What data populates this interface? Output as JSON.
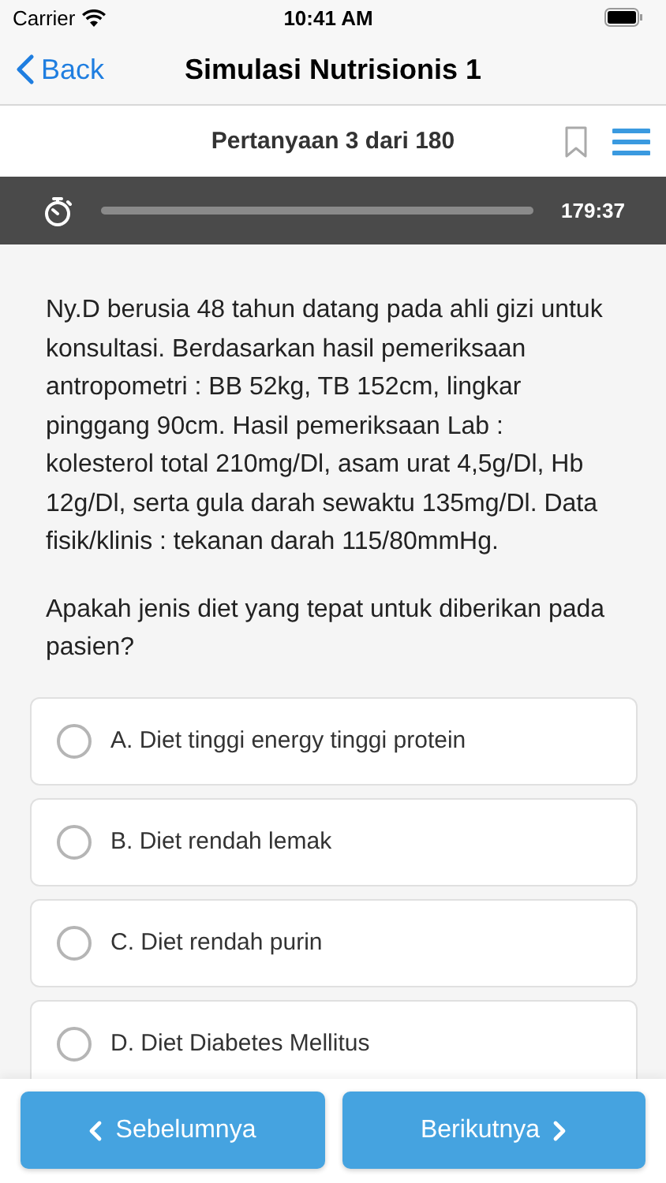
{
  "status_bar": {
    "carrier": "Carrier",
    "time": "10:41 AM"
  },
  "nav": {
    "back": "Back",
    "title": "Simulasi Nutrisionis 1"
  },
  "question_header": {
    "counter": "Pertanyaan 3 dari 180",
    "bookmarked": false
  },
  "timer": {
    "level": 1,
    "remaining": "179:37"
  },
  "question": {
    "paragraphs": [
      "Ny.D berusia 48 tahun datang pada ahli gizi untuk konsultasi. Berdasarkan hasil pemeriksaan antropometri : BB 52kg, TB 152cm, lingkar pinggang 90cm. Hasil pemeriksaan Lab : kolesterol total 210mg/Dl, asam urat 4,5g/Dl, Hb 12g/Dl, serta gula darah sewaktu 135mg/Dl. Data fisik/klinis : tekanan darah 115/80mmHg.",
      "Apakah jenis diet yang tepat untuk diberikan pada pasien?"
    ]
  },
  "options": [
    {
      "label": "A. Diet tinggi energy tinggi protein",
      "selected": false
    },
    {
      "label": "B. Diet rendah lemak",
      "selected": false
    },
    {
      "label": "C. Diet rendah purin",
      "selected": false
    },
    {
      "label": "D. Diet Diabetes Mellitus",
      "selected": false
    }
  ],
  "buttons": {
    "previous": "Sebelumnya",
    "next": "Berikutnya"
  }
}
